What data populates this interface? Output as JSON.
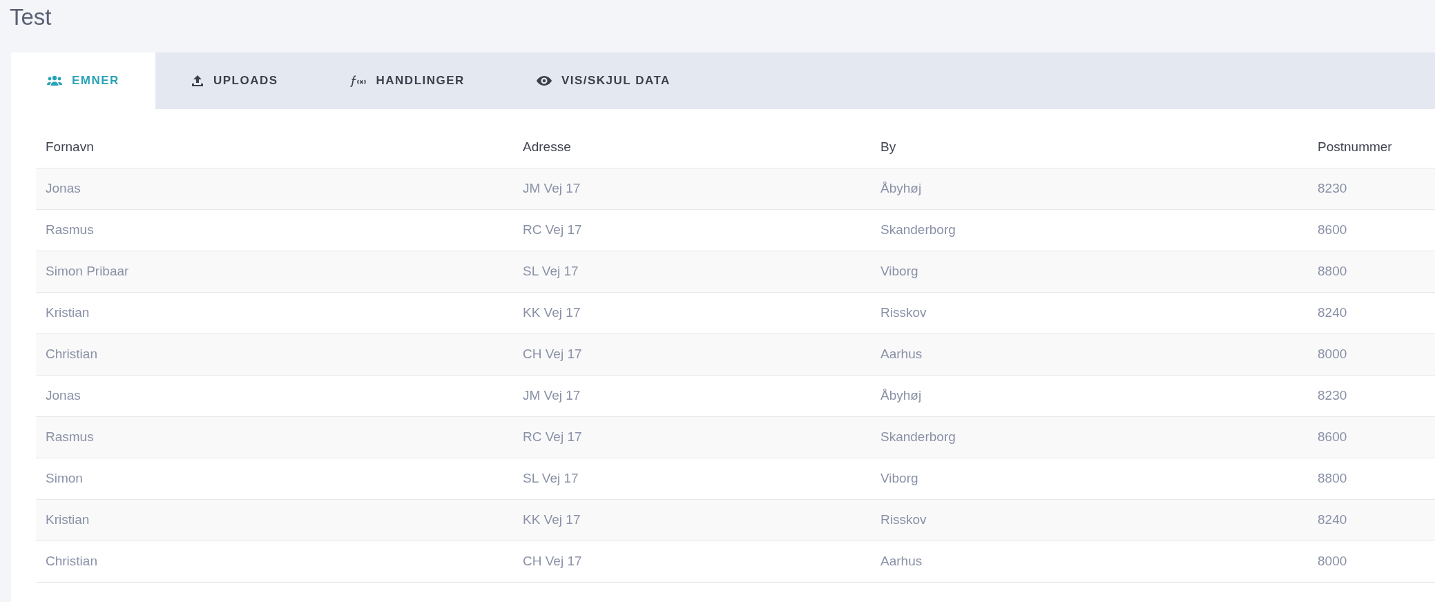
{
  "page_title": "Test",
  "tabs": [
    {
      "label": "EMNER",
      "selected": true
    },
    {
      "label": "UPLOADS",
      "selected": false
    },
    {
      "label": "HANDLINGER",
      "selected": false
    },
    {
      "label": "VIS/SKJUL DATA",
      "selected": false
    }
  ],
  "table": {
    "columns": [
      "Fornavn",
      "Adresse",
      "By",
      "Postnummer"
    ],
    "rows": [
      [
        "Jonas",
        "JM Vej 17",
        "Åbyhøj",
        "8230"
      ],
      [
        "Rasmus",
        "RC Vej 17",
        "Skanderborg",
        "8600"
      ],
      [
        "Simon Pribaar",
        "SL Vej 17",
        "Viborg",
        "8800"
      ],
      [
        "Kristian",
        "KK Vej 17",
        "Risskov",
        "8240"
      ],
      [
        "Christian",
        "CH Vej 17",
        "Aarhus",
        "8000"
      ],
      [
        "Jonas",
        "JM Vej 17",
        "Åbyhøj",
        "8230"
      ],
      [
        "Rasmus",
        "RC Vej 17",
        "Skanderborg",
        "8600"
      ],
      [
        "Simon",
        "SL Vej 17",
        "Viborg",
        "8800"
      ],
      [
        "Kristian",
        "KK Vej 17",
        "Risskov",
        "8240"
      ],
      [
        "Christian",
        "CH Vej 17",
        "Aarhus",
        "8000"
      ]
    ]
  }
}
